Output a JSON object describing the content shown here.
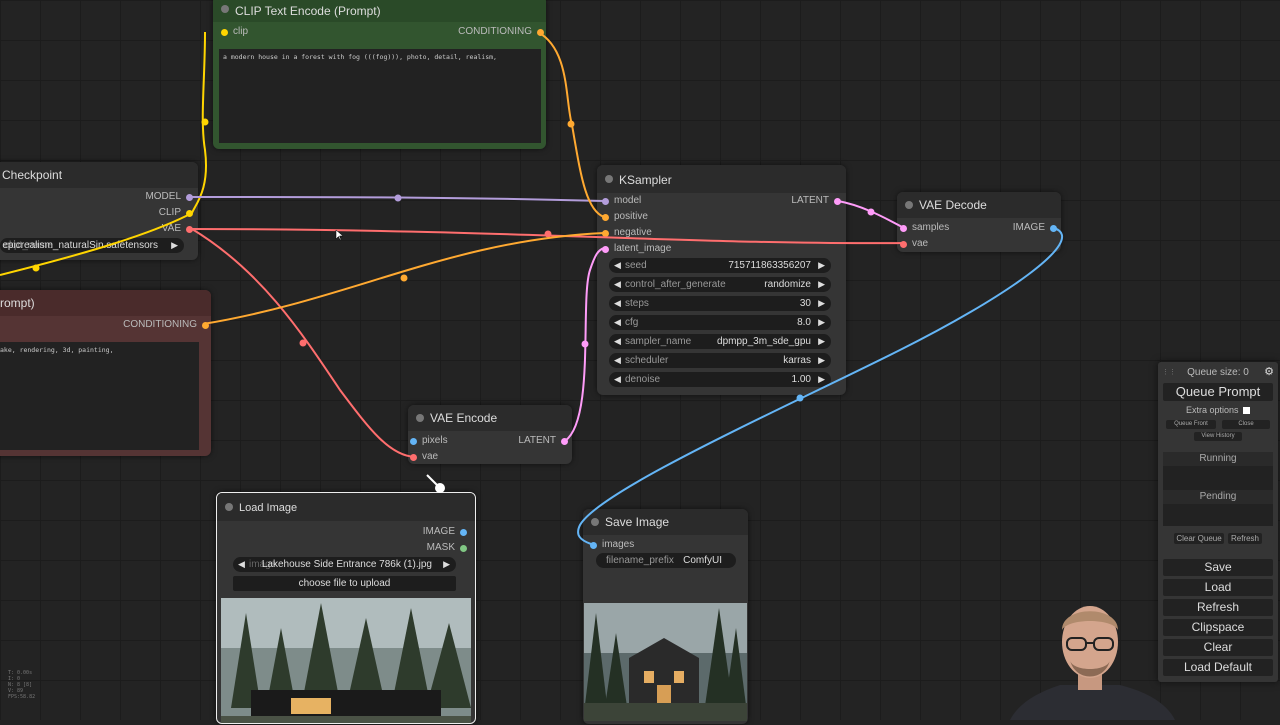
{
  "nodes": {
    "clip_pos": {
      "title": "CLIP Text Encode (Prompt)",
      "input_clip": "clip",
      "output": "CONDITIONING",
      "text": "a modern house in a forest with fog (((fog))), photo, detail, realism,"
    },
    "checkpoint": {
      "title": "Checkpoint",
      "out_model": "MODEL",
      "out_clip": "CLIP",
      "out_vae": "VAE",
      "ckpt_label": "ckpt_name",
      "ckpt_value": "epicrealism_naturalSin.safetensors"
    },
    "clip_neg": {
      "title": "rompt)",
      "output": "CONDITIONING",
      "text": "ake, rendering, 3d, painting,"
    },
    "ksampler": {
      "title": "KSampler",
      "in_model": "model",
      "in_positive": "positive",
      "in_negative": "negative",
      "in_latent": "latent_image",
      "output": "LATENT",
      "widgets": [
        {
          "label": "seed",
          "value": "715711863356207"
        },
        {
          "label": "control_after_generate",
          "value": "randomize"
        },
        {
          "label": "steps",
          "value": "30"
        },
        {
          "label": "cfg",
          "value": "8.0"
        },
        {
          "label": "sampler_name",
          "value": "dpmpp_3m_sde_gpu"
        },
        {
          "label": "scheduler",
          "value": "karras"
        },
        {
          "label": "denoise",
          "value": "1.00"
        }
      ]
    },
    "vae_decode": {
      "title": "VAE Decode",
      "in_samples": "samples",
      "in_vae": "vae",
      "output": "IMAGE"
    },
    "vae_encode": {
      "title": "VAE Encode",
      "in_pixels": "pixels",
      "in_vae": "vae",
      "output": "LATENT"
    },
    "load_image": {
      "title": "Load Image",
      "out_image": "IMAGE",
      "out_mask": "MASK",
      "image_label": "image",
      "image_value": "Lakehouse Side Entrance 786k (1).jpg",
      "upload_label": "choose file to upload"
    },
    "save_image": {
      "title": "Save Image",
      "in_images": "images",
      "prefix_label": "filename_prefix",
      "prefix_value": "ComfyUI"
    }
  },
  "panel": {
    "queue_size": "Queue size: 0",
    "queue_prompt": "Queue Prompt",
    "extra_options": "Extra options",
    "queue_front": "Queue Front",
    "close": "Close",
    "view_history": "View History",
    "running": "Running",
    "pending": "Pending",
    "clear_queue": "Clear Queue",
    "refresh_small": "Refresh",
    "save": "Save",
    "load": "Load",
    "refresh": "Refresh",
    "clipspace": "Clipspace",
    "clear": "Clear",
    "load_default": "Load Default"
  },
  "stats": [
    "T: 0.00s",
    "I: 0",
    "N: 8 [8]",
    "V: 89",
    "FPS:58.82"
  ],
  "colors": {
    "model_wire": "#b39ddb",
    "clip_wire": "#ffd500",
    "vae_wire": "#ff6e6e",
    "conditioning_wire": "#ffa931",
    "latent_wire": "#ff9cf9",
    "image_wire": "#64b5f6"
  }
}
